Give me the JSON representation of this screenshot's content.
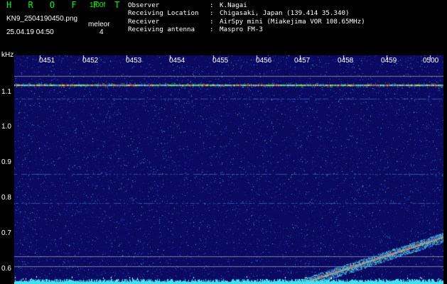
{
  "header": {
    "logo_text": "H R O F F T",
    "version": "1.00f",
    "filename": "KN9_2504190450.png",
    "mode_label": "meleor",
    "timestamp": "25.04.19 04:50",
    "mode_value": "4"
  },
  "info": [
    {
      "key": "Observer",
      "sep": ":",
      "value": "K.Nagai"
    },
    {
      "key": "Receiving Location",
      "sep": ":",
      "value": "Chigasaki, Japan (139.414 35.340)"
    },
    {
      "key": "Receiver",
      "sep": ":",
      "value": "AirSpy mini (Miakejima VOR 108.65MHz)"
    },
    {
      "key": "Receiving antenna",
      "sep": ":",
      "value": "Maspro FM-3"
    }
  ],
  "axis": {
    "y_unit": "kHz",
    "y_ticks": [
      "1.1",
      "1.0",
      "0.9",
      "0.8",
      "0.7",
      "0.6"
    ],
    "x_ticks": [
      "0451",
      "0452",
      "0453",
      "0454",
      "0455",
      "0456",
      "0457",
      "0458",
      "0459",
      "0500"
    ]
  },
  "spectrogram": {
    "y_range_khz": [
      0.56,
      1.14
    ],
    "features": [
      {
        "label": "carrier",
        "khz": 1.064,
        "color": "#ff4040"
      },
      {
        "label": "line",
        "khz": 1.088,
        "color": "#40c0a0"
      },
      {
        "label": "line",
        "khz": 0.765,
        "color": "#40c0a0"
      },
      {
        "label": "line",
        "khz": 0.63,
        "color": "#40c0a0"
      }
    ],
    "background_color": "#0a0a60",
    "grid_color": "#c8c8c8"
  }
}
